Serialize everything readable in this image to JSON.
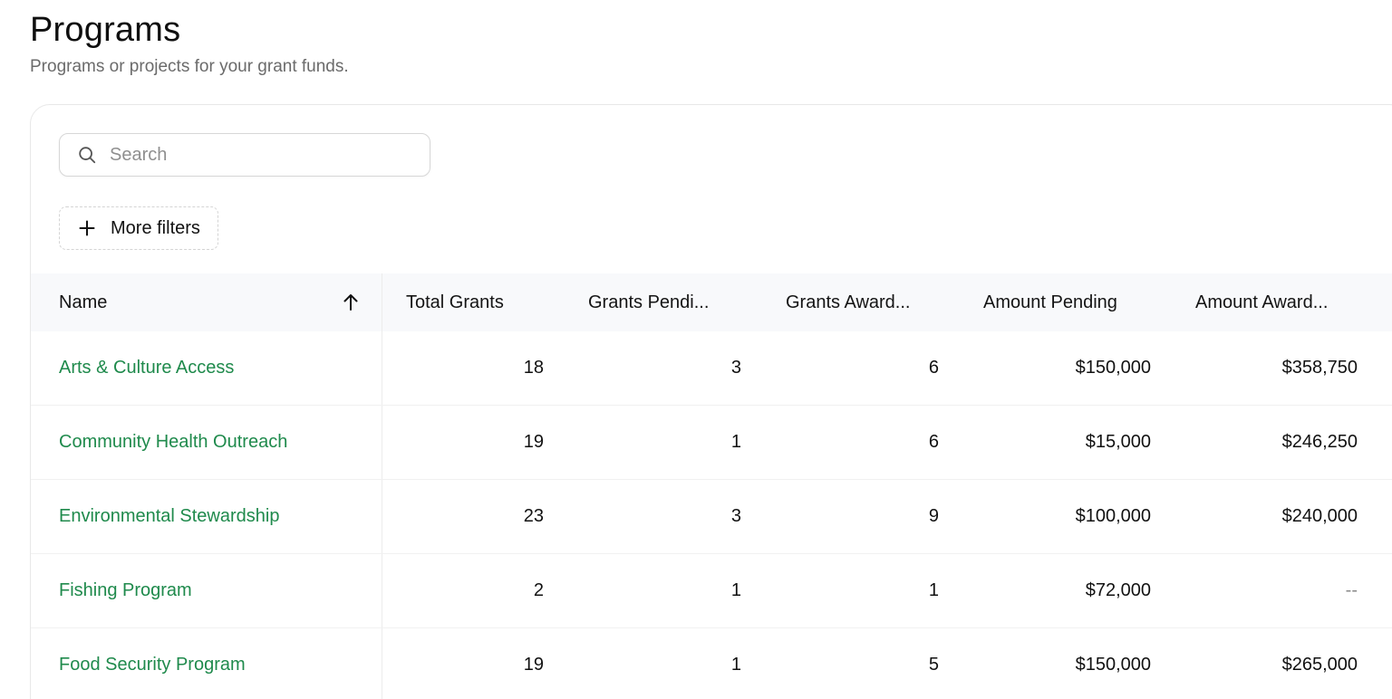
{
  "header": {
    "title": "Programs",
    "subtitle": "Programs or projects for your grant funds."
  },
  "search": {
    "placeholder": "Search",
    "value": ""
  },
  "filters": {
    "more_filters_label": "More filters"
  },
  "table": {
    "columns": {
      "name": "Name",
      "total_grants": "Total Grants",
      "grants_pending": "Grants Pendi...",
      "grants_awarded": "Grants Award...",
      "amount_pending": "Amount Pending",
      "amount_awarded": "Amount Award..."
    },
    "sort": {
      "column": "Name",
      "direction": "ascending",
      "icon": "arrow-up-icon"
    },
    "rows": [
      {
        "name": "Arts & Culture Access",
        "total_grants": "18",
        "grants_pending": "3",
        "grants_awarded": "6",
        "amount_pending": "$150,000",
        "amount_awarded": "$358,750"
      },
      {
        "name": "Community Health Outreach",
        "total_grants": "19",
        "grants_pending": "1",
        "grants_awarded": "6",
        "amount_pending": "$15,000",
        "amount_awarded": "$246,250"
      },
      {
        "name": "Environmental Stewardship",
        "total_grants": "23",
        "grants_pending": "3",
        "grants_awarded": "9",
        "amount_pending": "$100,000",
        "amount_awarded": "$240,000"
      },
      {
        "name": "Fishing Program",
        "total_grants": "2",
        "grants_pending": "1",
        "grants_awarded": "1",
        "amount_pending": "$72,000",
        "amount_awarded": "--"
      },
      {
        "name": "Food Security Program",
        "total_grants": "19",
        "grants_pending": "1",
        "grants_awarded": "5",
        "amount_pending": "$150,000",
        "amount_awarded": "$265,000"
      }
    ]
  },
  "icons": {
    "search": "search-icon",
    "plus": "plus-icon",
    "sort": "arrow-up-icon"
  },
  "colors": {
    "link_green": "#1f8a4c",
    "header_bg": "#f8f9fb",
    "subtitle_gray": "#6b6b6b"
  }
}
